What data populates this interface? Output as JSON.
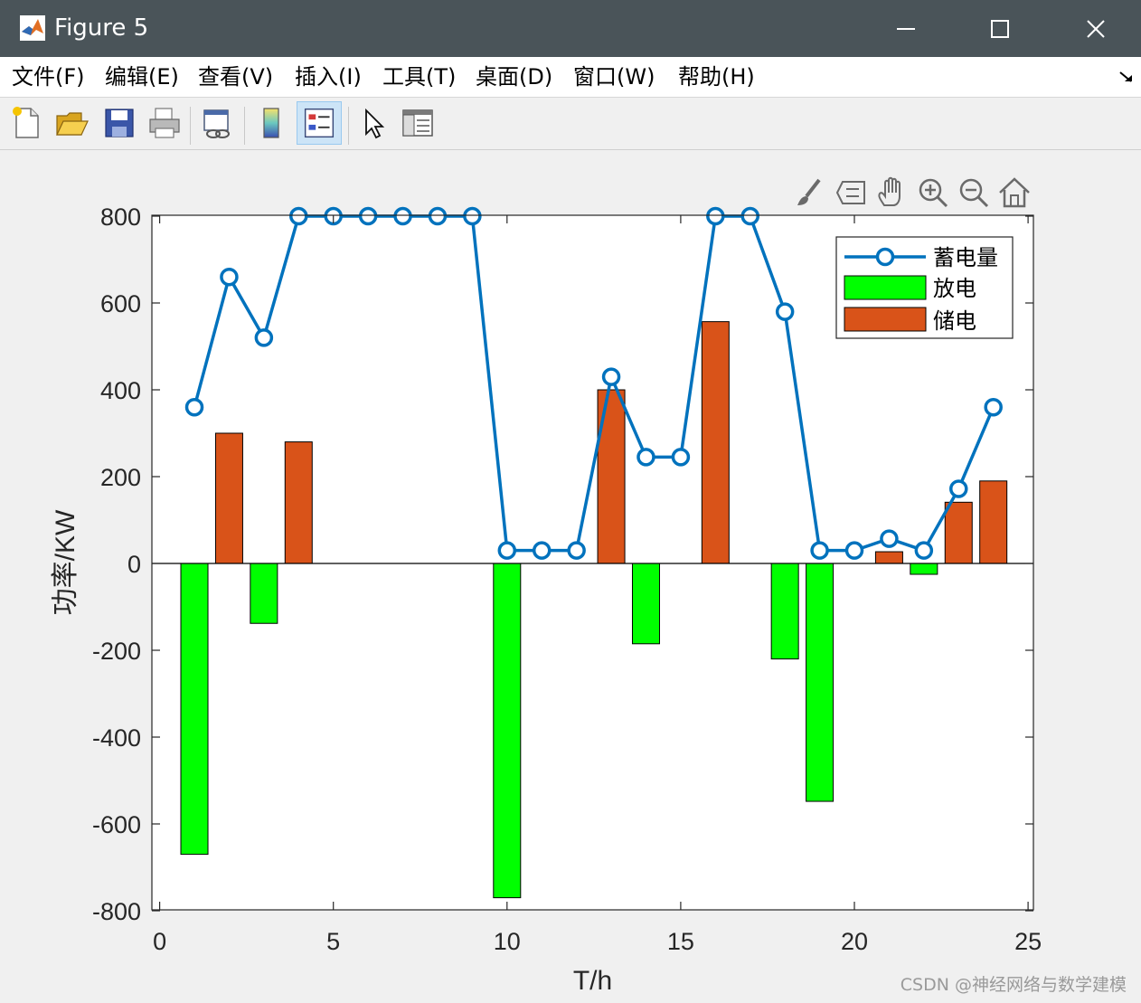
{
  "window": {
    "title": "Figure 5"
  },
  "menu": {
    "items": [
      "文件(F)",
      "编辑(E)",
      "查看(V)",
      "插入(I)",
      "工具(T)",
      "桌面(D)",
      "窗口(W)",
      "帮助(H)"
    ]
  },
  "toolbar": {
    "buttons": [
      "new-figure",
      "open-file",
      "save-figure",
      "print-figure",
      "link-plot",
      "insert-colorbar",
      "insert-legend",
      "edit-plot",
      "property-inspector"
    ]
  },
  "colors": {
    "titlebar": "#4a5459",
    "storage_line": "#0072bd",
    "discharge": "#00ff00",
    "charge": "#d95319"
  },
  "watermark": "CSDN @神经网络与数学建模",
  "chart_data": {
    "type": "bar",
    "xlabel": "T/h",
    "ylabel": "功率/KW",
    "xlim": [
      0,
      25
    ],
    "ylim": [
      -800,
      800
    ],
    "xticks": [
      0,
      5,
      10,
      15,
      20,
      25
    ],
    "yticks": [
      -800,
      -600,
      -400,
      -200,
      0,
      200,
      400,
      600,
      800
    ],
    "legend_position": "top-right",
    "grid": false,
    "series": [
      {
        "name": "蓄电量",
        "type": "line",
        "marker": "circle",
        "x": [
          1,
          2,
          3,
          4,
          5,
          6,
          7,
          8,
          9,
          10,
          11,
          12,
          13,
          14,
          15,
          16,
          17,
          18,
          19,
          20,
          21,
          22,
          23,
          24
        ],
        "values": [
          360,
          660,
          520,
          800,
          800,
          800,
          800,
          800,
          800,
          30,
          30,
          30,
          430,
          245,
          245,
          800,
          800,
          580,
          30,
          30,
          57,
          30,
          172,
          360
        ]
      },
      {
        "name": "放电",
        "type": "bar",
        "x": [
          1,
          3,
          10,
          14,
          18,
          19,
          22
        ],
        "values": [
          -670,
          -138,
          -770,
          -185,
          -220,
          -548,
          -25
        ]
      },
      {
        "name": "储电",
        "type": "bar",
        "x": [
          2,
          4,
          13,
          16,
          21,
          23,
          24
        ],
        "values": [
          300,
          280,
          400,
          557,
          27,
          141,
          190
        ]
      }
    ]
  }
}
